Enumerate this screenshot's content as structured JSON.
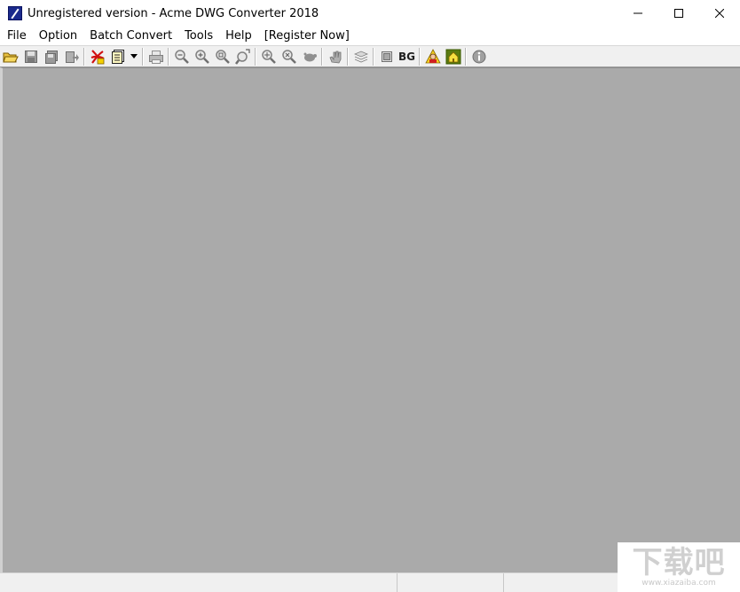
{
  "window": {
    "title": "Unregistered version - Acme DWG Converter 2018"
  },
  "menubar": {
    "items": [
      "File",
      "Option",
      "Batch Convert",
      "Tools",
      "Help",
      "[Register Now]"
    ]
  },
  "toolbar": {
    "bg_label": "BG",
    "icons": [
      "open-folder-icon",
      "save-icon",
      "save-all-icon",
      "export-icon",
      "convert-pdf-icon",
      "batch-convert-icon",
      "dropdown-arrow-icon",
      "print-icon",
      "zoom-out-icon",
      "zoom-in-icon",
      "zoom-window-icon",
      "zoom-pan-icon",
      "zoom-extents-icon",
      "zoom-previous-icon",
      "zoom-realtime-icon",
      "pan-hand-icon",
      "layers-icon",
      "background-icon",
      "user-help-icon",
      "home-icon",
      "info-icon"
    ]
  },
  "watermark": {
    "url": "www.xiazaiba.com"
  },
  "colors": {
    "workarea": "#aaaaaa",
    "toolbar": "#f0f0f0",
    "titlebar": "#ffffff"
  }
}
